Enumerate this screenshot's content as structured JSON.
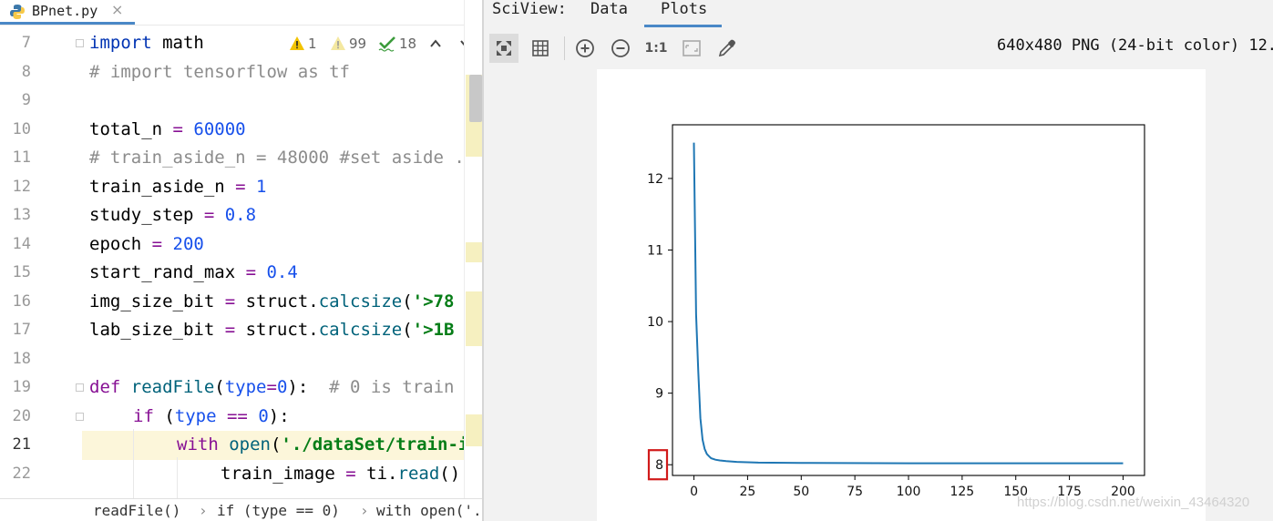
{
  "editor": {
    "tab": {
      "filename": "BPnet.py",
      "close_glyph": "×"
    },
    "inspections": {
      "warnings": "1",
      "weak_warnings": "99",
      "typos": "18"
    },
    "lines": [
      {
        "n": "7"
      },
      {
        "n": "8"
      },
      {
        "n": "9"
      },
      {
        "n": "10"
      },
      {
        "n": "11"
      },
      {
        "n": "12"
      },
      {
        "n": "13"
      },
      {
        "n": "14"
      },
      {
        "n": "15"
      },
      {
        "n": "16"
      },
      {
        "n": "17"
      },
      {
        "n": "18"
      },
      {
        "n": "19"
      },
      {
        "n": "20"
      },
      {
        "n": "21"
      },
      {
        "n": "22"
      }
    ],
    "code": {
      "l7_kw": "import",
      "l7_rest": " math",
      "l8": "# import tensorflow as tf",
      "l10_name": "total_n ",
      "l10_eq": "=",
      "l10_val": " 60000",
      "l11": "# train_aside_n = 48000 #set aside .",
      "l12_name": "train_aside_n ",
      "l12_eq": "=",
      "l12_val": " 1",
      "l13_name": "study_step ",
      "l13_eq": "=",
      "l13_val": " 0.8",
      "l14_name": "epoch ",
      "l14_eq": "=",
      "l14_val": " 200",
      "l15_name": "start_rand_max ",
      "l15_eq": "=",
      "l15_val": " 0.4",
      "l16_name": "img_size_bit ",
      "l16_eq": "=",
      "l16_mid": " struct.",
      "l16_fn": "calcsize",
      "l16_open": "(",
      "l16_str": "'>78",
      "l17_name": "lab_size_bit ",
      "l17_eq": "=",
      "l17_mid": " struct.",
      "l17_fn": "calcsize",
      "l17_open": "(",
      "l17_str": "'>1B",
      "l19_kw": "def",
      "l19_fn": " readFile",
      "l19_open": "(",
      "l19_param": "type",
      "l19_eq": "=",
      "l19_num": "0",
      "l19_close": "):",
      "l19_cmt": "  # 0 is train",
      "l20_kw": "if",
      "l20_open": " (",
      "l20_param": "type",
      "l20_op": " ==",
      "l20_num": " 0",
      "l20_close": "):",
      "l21_kw": "with",
      "l21_fn": " open",
      "l21_open": "(",
      "l21_str": "'./dataSet/train-i",
      "l22_name": "train_image ",
      "l22_eq": "=",
      "l22_mid": " ti.",
      "l22_fn": "read",
      "l22_close": "()"
    },
    "breadcrumb": [
      "readFile()",
      "if (type == 0)",
      "with open('."
    ]
  },
  "sciview": {
    "title": "SciView:",
    "tabs": [
      "Data",
      "Plots"
    ],
    "active_tab": "Plots",
    "toolbar": {
      "icons": [
        "fit-view-icon",
        "grid-icon",
        "zoom-in-icon",
        "zoom-out-icon",
        "actual-size-icon",
        "fit-window-icon",
        "color-picker-icon"
      ],
      "actual_size_label": "1:1"
    },
    "image_info": "640x480 PNG (24-bit color) 12.9",
    "watermark": "https://blog.csdn.net/weixin_43464320"
  },
  "chart_data": {
    "type": "line",
    "title": "",
    "xlabel": "",
    "ylabel": "",
    "xlim": [
      -10,
      210
    ],
    "ylim": [
      7.85,
      12.75
    ],
    "xticks": [
      0,
      25,
      50,
      75,
      100,
      125,
      150,
      175,
      200
    ],
    "yticks": [
      8,
      9,
      10,
      11,
      12
    ],
    "highlighted_ytick": 8,
    "grid": false,
    "series": [
      {
        "color": "#1f77b4",
        "x": [
          0,
          1,
          2,
          3,
          4,
          5,
          6,
          7,
          8,
          10,
          12,
          15,
          20,
          30,
          50,
          100,
          150,
          200
        ],
        "y": [
          12.5,
          10.1,
          9.3,
          8.65,
          8.35,
          8.22,
          8.15,
          8.12,
          8.09,
          8.07,
          8.06,
          8.05,
          8.04,
          8.03,
          8.025,
          8.02,
          8.02,
          8.02
        ]
      }
    ]
  }
}
